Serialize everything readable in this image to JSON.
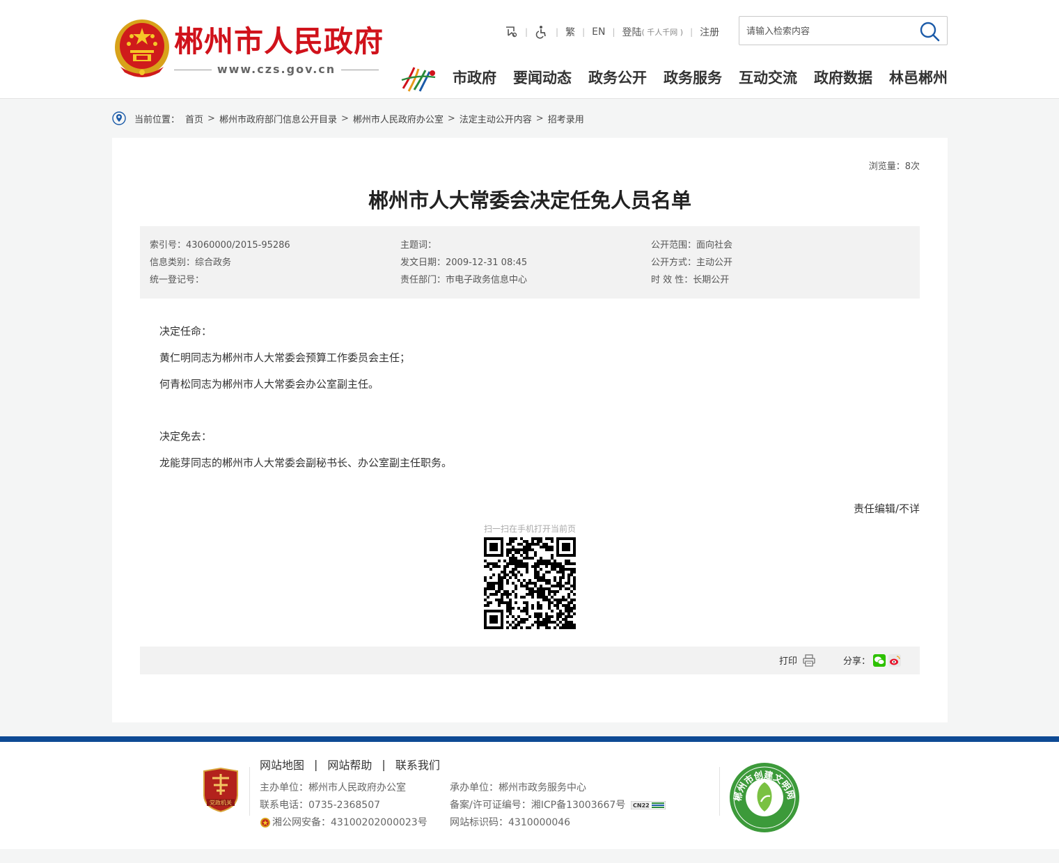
{
  "header": {
    "site_name": "郴州市人民政府",
    "site_url": "www.czs.gov.cn",
    "toplinks": {
      "accessibility_label": "繁",
      "english": "EN",
      "login": "登陆",
      "login_sub": "( 千人千网 )",
      "register": "注册"
    },
    "search": {
      "placeholder": "请输入检索内容"
    },
    "nav": [
      "市政府",
      "要闻动态",
      "政务公开",
      "政务服务",
      "互动交流",
      "政府数据",
      "林邑郴州"
    ]
  },
  "breadcrumb": {
    "label": "当前位置：",
    "items": [
      "首页",
      "郴州市政府部门信息公开目录",
      "郴州市人民政府办公室",
      "法定主动公开内容",
      "招考录用"
    ]
  },
  "article": {
    "views": "浏览量：8次",
    "title": "郴州市人大常委会决定任免人员名单",
    "meta": {
      "index_no": "索引号：43060000/2015-95286",
      "keywords": "主题词：",
      "scope": "公开范围：面向社会",
      "category": "信息类别：综合政务",
      "date": "发文日期：2009-12-31 08:45",
      "method": "公开方式：主动公开",
      "reg_no": "统一登记号：",
      "dept": "责任部门：市电子政务信息中心",
      "validity": "时 效 性：长期公开"
    },
    "paragraphs": [
      "决定任命：",
      "黄仁明同志为郴州市人大常委会预算工作委员会主任；",
      "何青松同志为郴州市人大常委会办公室副主任。",
      "决定免去：",
      "龙能芽同志的郴州市人大常委会副秘书长、办公室副主任职务。"
    ],
    "editor": "责任编辑/不详",
    "qr_caption": "扫一扫在手机打开当前页",
    "print_label": "打印",
    "share_label": "分享："
  },
  "footer": {
    "links": [
      "网站地图",
      "网站帮助",
      "联系我们"
    ],
    "party_badge": "党政机关",
    "host": "主办单位：郴州市人民政府办公室",
    "phone": "联系电话：0735-2368507",
    "police": "湘公网安备：43100202000023号",
    "undertaker": "承办单位：郴州市政务服务中心",
    "icp": "备案/许可证编号：湘ICP备13003667号",
    "site_code": "网站标识码：4310000046",
    "cn22": "CN22",
    "wenming_text": "郴州市创建文明网站"
  },
  "colors": {
    "brand_red": "#d0121b",
    "footer_blue": "#0e4a94",
    "wechat_green": "#2dc100"
  }
}
